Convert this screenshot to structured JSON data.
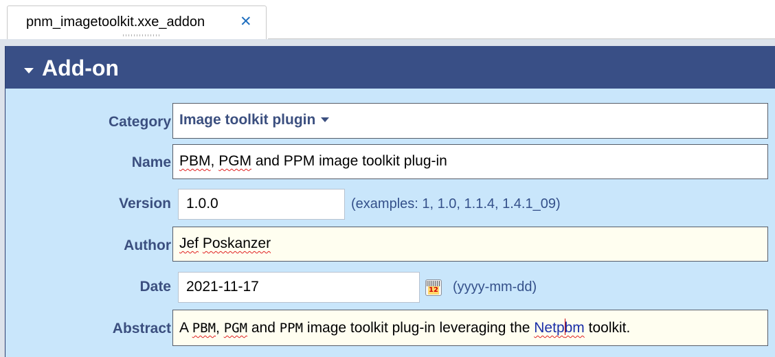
{
  "tab": {
    "title": "pnm_imagetoolkit.xxe_addon",
    "close_glyph": "✕"
  },
  "section": {
    "title": "Add-on"
  },
  "fields": {
    "category": {
      "label": "Category",
      "value": "Image toolkit plugin"
    },
    "name": {
      "label": "Name",
      "parts": [
        "PBM",
        ", ",
        "PGM",
        " and PPM image toolkit plug-in"
      ]
    },
    "version": {
      "label": "Version",
      "value": "1.0.0",
      "hint": "(examples: 1, 1.0, 1.1.4, 1.4.1_09)"
    },
    "author": {
      "label": "Author",
      "parts": [
        "Jef",
        " ",
        "Poskanzer"
      ]
    },
    "date": {
      "label": "Date",
      "value": "2021-11-17",
      "hint": "(yyyy-mm-dd)",
      "calendar_day": "12"
    },
    "abstract": {
      "label": "Abstract",
      "parts": [
        "A ",
        "PBM",
        ", ",
        "PGM",
        " and ",
        "PPM",
        " image toolkit plug-in leveraging the ",
        "Netp",
        "bm",
        " toolkit."
      ]
    }
  },
  "colors": {
    "header_bg": "#394f86",
    "section_bg": "#c9e6fb",
    "label_color": "#3b4f7f",
    "author_field_bg": "#fffef0",
    "abstract_field_bg": "#fffef0",
    "link_color": "#1b2fa8"
  },
  "icons": {
    "section_toggle": "collapse-triangle-icon",
    "category_dropdown": "chevron-down-icon",
    "calendar": "calendar-icon",
    "tab_close": "close-icon"
  }
}
